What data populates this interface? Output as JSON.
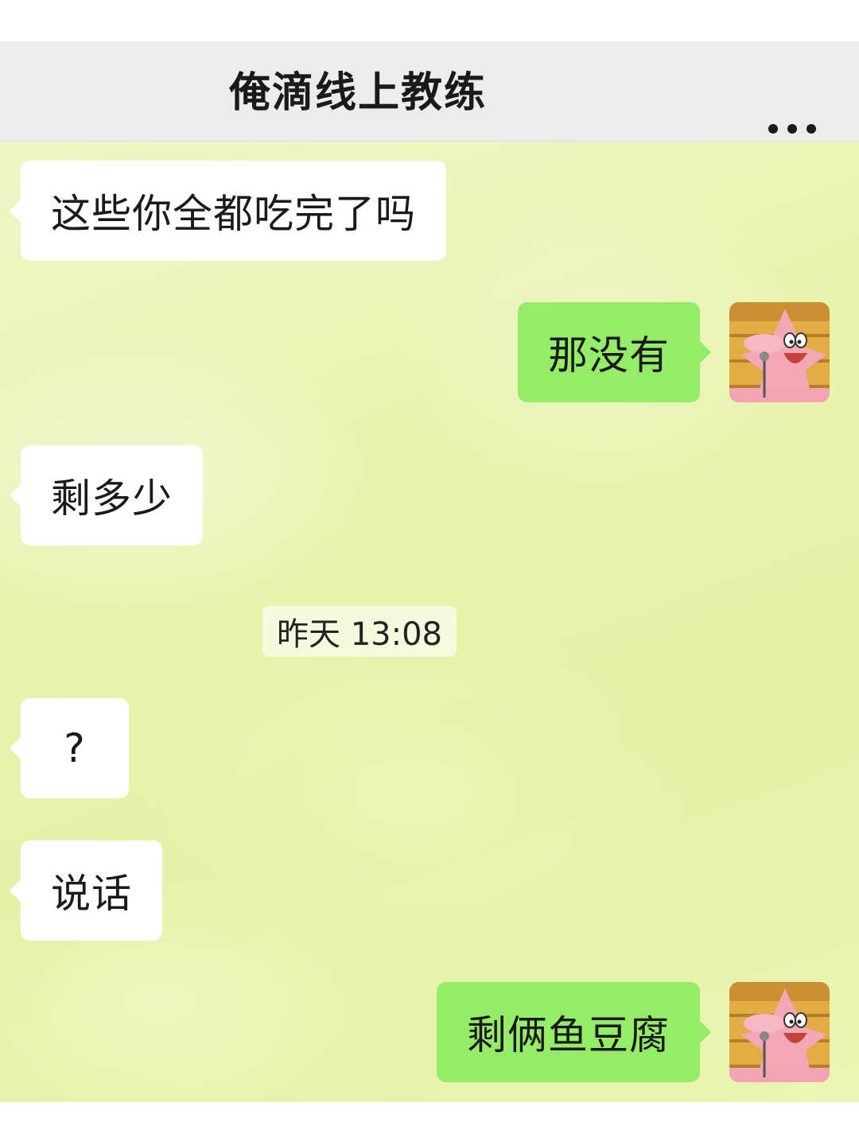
{
  "header": {
    "title": "俺滴线上教练",
    "more_icon": "more-dots-icon"
  },
  "messages": [
    {
      "side": "in",
      "text": "这些你全都吃完了吗"
    },
    {
      "side": "out",
      "text": "那没有",
      "avatar": "patrick-star-avatar"
    },
    {
      "side": "in",
      "text": "剩多少"
    },
    {
      "side": "in",
      "text": "?"
    },
    {
      "side": "in",
      "text": "说话"
    },
    {
      "side": "out",
      "text": "剩俩鱼豆腐",
      "avatar": "patrick-star-avatar"
    }
  ],
  "timestamp": "昨天 13:08",
  "colors": {
    "topbar_bg": "#ececec",
    "chat_bg": "#e8f3b0",
    "incoming_bubble": "#ffffff",
    "outgoing_bubble": "#95ec69",
    "text": "#1a1a1a"
  }
}
